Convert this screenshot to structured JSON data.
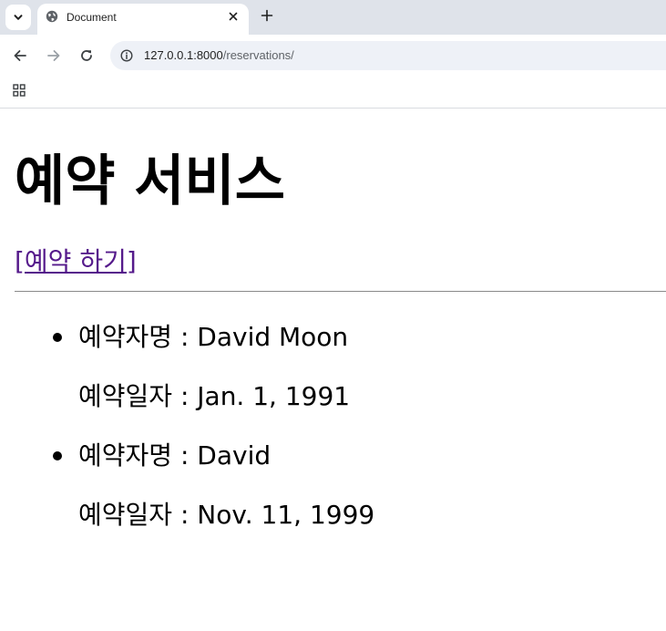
{
  "browser": {
    "tab_title": "Document",
    "url_host": "127.0.0.1:8000",
    "url_path": "/reservations/",
    "icons": {
      "tab_search": "chevron-down-icon",
      "favicon": "globe-icon",
      "close": "close-icon",
      "new_tab": "plus-icon",
      "back": "back-arrow-icon",
      "forward": "forward-arrow-icon",
      "reload": "reload-icon",
      "site_info": "info-icon",
      "apps": "apps-grid-icon"
    }
  },
  "page": {
    "title": "예약 서비스",
    "reserve_link": "[예약 하기]",
    "link_color": "#551a8b",
    "reservations": [
      {
        "name_line": "예약자명 : David Moon",
        "date_line": "예약일자 : Jan. 1, 1991"
      },
      {
        "name_line": "예약자명 : David",
        "date_line": "예약일자 : Nov. 11, 1999"
      }
    ]
  }
}
